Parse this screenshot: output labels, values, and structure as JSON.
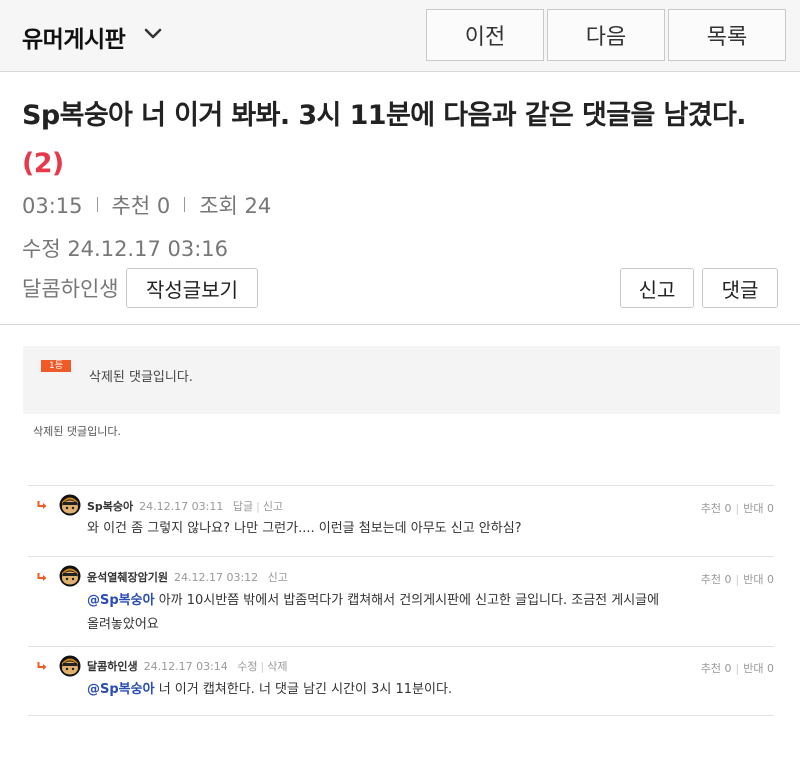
{
  "topbar": {
    "board_title": "유머게시판",
    "prev_label": "이전",
    "next_label": "다음",
    "list_label": "목록"
  },
  "post": {
    "title": "Sp복숭아 너 이거 봐봐. 3시 11분에 다음과 같은 댓글을 남겼다.",
    "comment_count": "(2)",
    "time": "03:15",
    "recommend": "추천 0",
    "views": "조회 24",
    "edited": "수정 24.12.17  03:16",
    "author": "달콤하인생",
    "view_posts_label": "작성글보기",
    "report_label": "신고",
    "comment_label": "댓글"
  },
  "best": {
    "badge": "1등",
    "text": "삭제된 댓글입니다."
  },
  "deleted_notice": "삭제된 댓글입니다.",
  "comments": [
    {
      "nick": "Sp복숭아",
      "date": "24.12.17 03:11",
      "actions": [
        "답글",
        "신고"
      ],
      "recommend": "추천 0",
      "oppose": "반대 0",
      "mention": "",
      "lines": [
        "와 이건 좀 그렇지 않나요? 나만 그런가.... 이런글 첨보는데 아무도 신고 안하심?"
      ]
    },
    {
      "nick": "윤석열췌장암기원",
      "date": "24.12.17 03:12",
      "actions": [
        "신고"
      ],
      "recommend": "추천 0",
      "oppose": "반대 0",
      "mention": "@Sp복숭아",
      "lines": [
        " 아까 10시반쯤 밖에서 밥좀먹다가 캡쳐해서 건의게시판에 신고한 글입니다. 조금전 게시글에",
        "올려놓았어요"
      ]
    },
    {
      "nick": "달콤하인생",
      "date": "24.12.17 03:14",
      "actions": [
        "수정",
        "삭제"
      ],
      "recommend": "추천 0",
      "oppose": "반대 0",
      "mention": "@Sp복숭아",
      "lines": [
        " 너 이거 캡쳐한다. 너 댓글 남긴 시간이 3시 11분이다."
      ]
    }
  ],
  "icons": {
    "dropdown": "chevron-down-icon",
    "reply_arrow": "reply-arrow-icon",
    "avatar": "avatar-icon"
  },
  "colors": {
    "accent_red": "#e8394c",
    "mention_blue": "#2a4cb3",
    "reply_orange": "#f05a28"
  }
}
